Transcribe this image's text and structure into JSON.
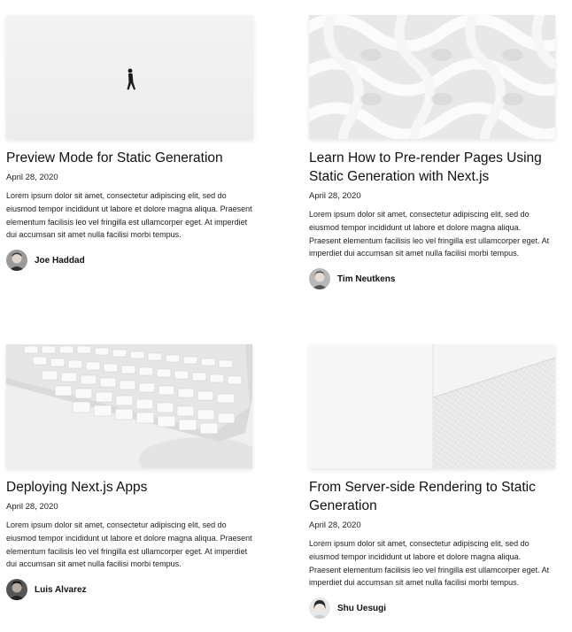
{
  "posts": [
    {
      "title": "Preview Mode for Static Generation",
      "date": "April 28, 2020",
      "excerpt": "Lorem ipsum dolor sit amet, consectetur adipiscing elit, sed do eiusmod tempor incididunt ut labore et dolore magna aliqua. Praesent elementum facilisis leo vel fringilla est ullamcorper eget. At imperdiet dui accumsan sit amet nulla facilisi morbi tempus.",
      "author": "Joe Haddad",
      "cover_icon": "person-walking-snow-image"
    },
    {
      "title": "Learn How to Pre-render Pages Using Static Generation with Next.js",
      "date": "April 28, 2020",
      "excerpt": "Lorem ipsum dolor sit amet, consectetur adipiscing elit, sed do eiusmod tempor incididunt ut labore et dolore magna aliqua. Praesent elementum facilisis leo vel fringilla est ullamcorper eget. At imperdiet dui accumsan sit amet nulla facilisi morbi tempus.",
      "author": "Tim Neutkens",
      "cover_icon": "woven-pattern-image"
    },
    {
      "title": "Deploying Next.js Apps",
      "date": "April 28, 2020",
      "excerpt": "Lorem ipsum dolor sit amet, consectetur adipiscing elit, sed do eiusmod tempor incididunt ut labore et dolore magna aliqua. Praesent elementum facilisis leo vel fringilla est ullamcorper eget. At imperdiet dui accumsan sit amet nulla facilisi morbi tempus.",
      "author": "Luis Alvarez",
      "cover_icon": "keyboard-image"
    },
    {
      "title": "From Server-side Rendering to Static Generation",
      "date": "April 28, 2020",
      "excerpt": "Lorem ipsum dolor sit amet, consectetur adipiscing elit, sed do eiusmod tempor incididunt ut labore et dolore magna aliqua. Praesent elementum facilisis leo vel fringilla est ullamcorper eget. At imperdiet dui accumsan sit amet nulla facilisi morbi tempus.",
      "author": "Shu Uesugi",
      "cover_icon": "white-building-image"
    }
  ],
  "colors": {
    "text": "#111111",
    "background": "#ffffff"
  }
}
